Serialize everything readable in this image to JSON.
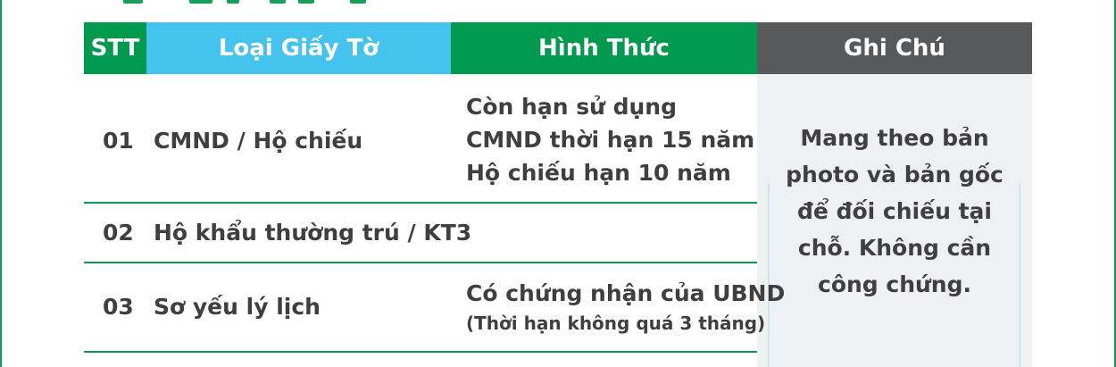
{
  "table": {
    "headers": {
      "stt": "STT",
      "loai": "Loại Giấy Tờ",
      "hinh": "Hình Thức",
      "ghi": "Ghi Chú"
    },
    "rows": [
      {
        "stt": "01",
        "loai": "CMND / Hộ chiếu",
        "hinh_lines": [
          "Còn hạn sử dụng",
          "CMND thời hạn 15 năm",
          "Hộ chiếu hạn 10 năm"
        ]
      },
      {
        "stt": "02",
        "loai": "Hộ khẩu thường trú / KT3",
        "hinh_lines": []
      },
      {
        "stt": "03",
        "loai": "Sơ yếu lý lịch",
        "hinh_lines": [
          "Có chứng nhận của UBND",
          "(Thời hạn không quá 3 tháng)"
        ]
      }
    ],
    "note": "Mang theo bản photo và bản gốc để đối chiếu tại chỗ. Không cần công chứng."
  },
  "colors": {
    "green": "#009a4e",
    "blue": "#43c3ee",
    "gray_header": "#58595b",
    "note_bg": "#eff0f2",
    "text": "#3f3f41"
  }
}
